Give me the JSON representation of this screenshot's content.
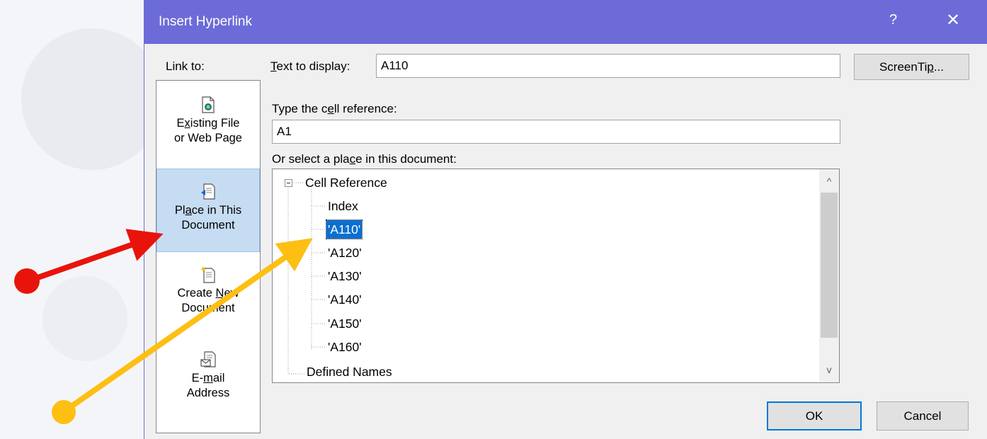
{
  "dialog": {
    "title": "Insert Hyperlink",
    "help_glyph": "?",
    "close_glyph": "✕",
    "title_bar_color": "#6c6bd8"
  },
  "link_to": {
    "label": "Link to:",
    "items": [
      {
        "line1_pre": "E",
        "line1_u": "x",
        "line1_post": "isting File",
        "line2": "or Web Page",
        "icon": "existing-file-icon"
      },
      {
        "line1_pre": "Pl",
        "line1_u": "a",
        "line1_post": "ce in This",
        "line2": "Document",
        "icon": "place-in-document-icon",
        "selected": true
      },
      {
        "line1_pre": "Create ",
        "line1_u": "N",
        "line1_post": "ew",
        "line2": "Document",
        "icon": "new-document-icon"
      },
      {
        "line1_pre": "E-",
        "line1_u": "m",
        "line1_post": "ail",
        "line2": "Address",
        "icon": "email-icon"
      }
    ]
  },
  "text_to_display": {
    "label_u": "T",
    "label_rest": "ext to display:",
    "value": "A110"
  },
  "screentip": {
    "pre": "ScreenTi",
    "u": "p",
    "post": "..."
  },
  "cell_ref": {
    "label_pre": "Type the c",
    "label_u": "e",
    "label_post": "ll reference:",
    "value": "A1"
  },
  "place": {
    "label_pre": "Or select a pla",
    "label_u": "c",
    "label_post": "e in this document:"
  },
  "tree": {
    "root": "Cell Reference",
    "children": [
      "Index",
      "'A110'",
      "'A120'",
      "'A130'",
      "'A140'",
      "'A150'",
      "'A160'"
    ],
    "selected": "'A110'",
    "second_root": "Defined Names",
    "scroll_up": "^",
    "scroll_down": "v"
  },
  "buttons": {
    "ok": "OK",
    "cancel": "Cancel"
  },
  "annotations": {
    "red_arrow_color": "#e8140c",
    "yellow_arrow_color": "#fdbf12"
  }
}
